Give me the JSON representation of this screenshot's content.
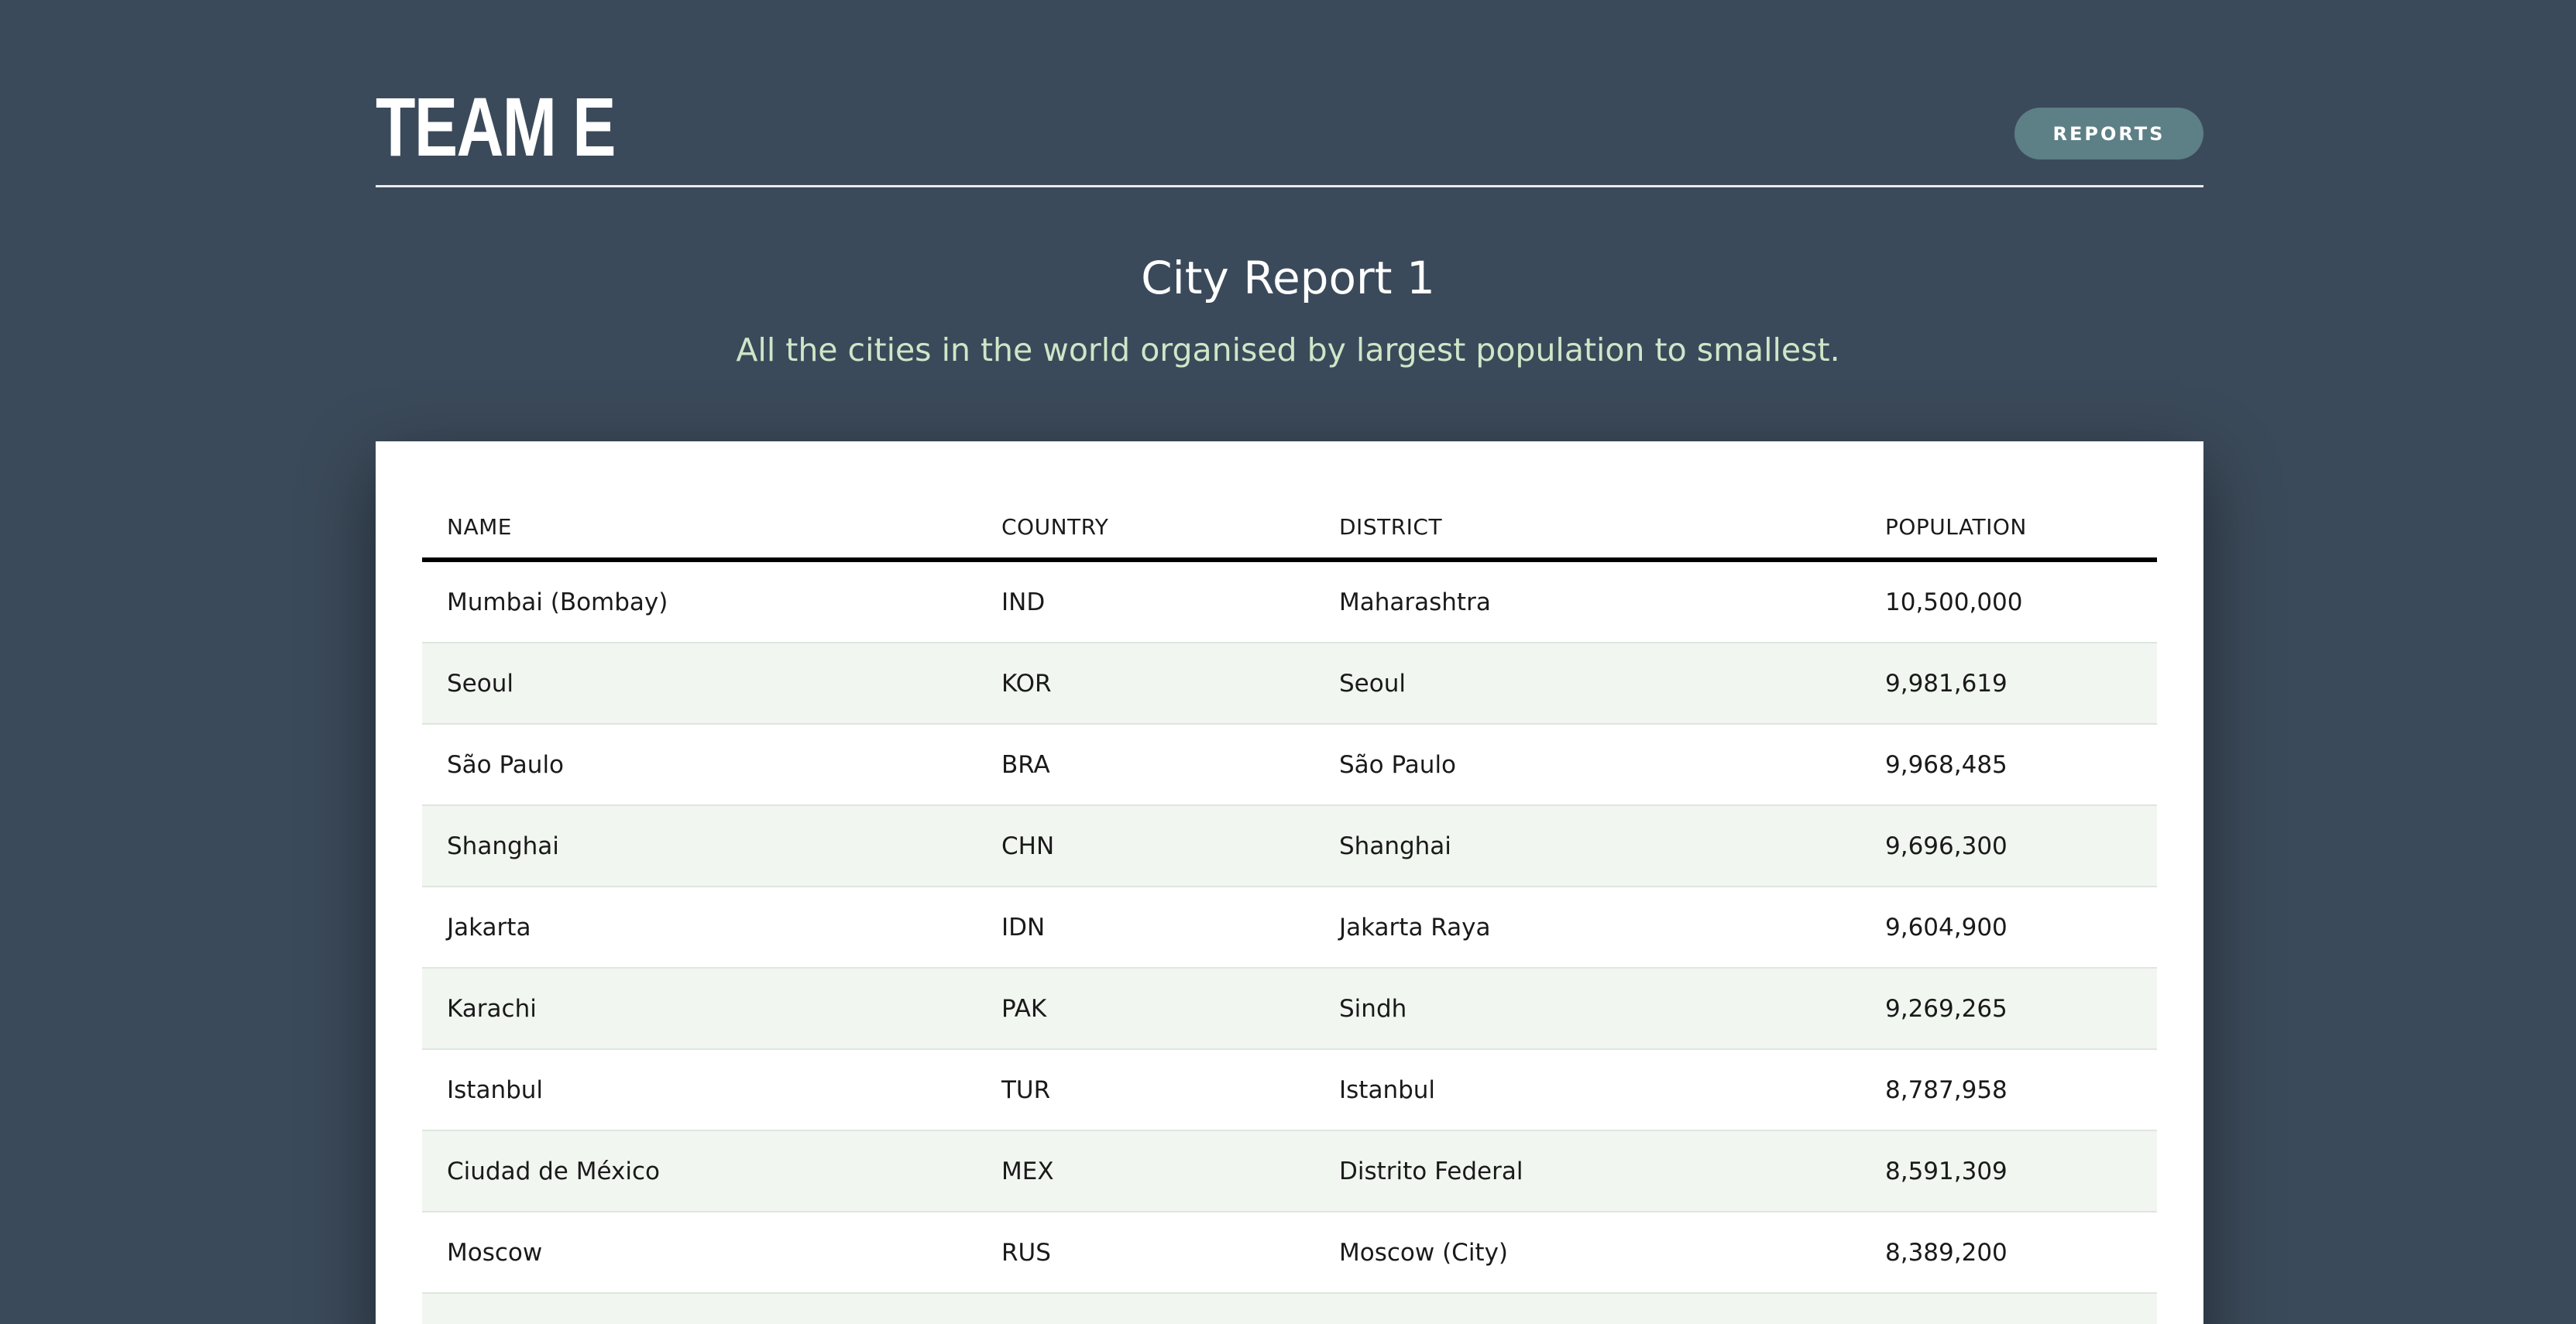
{
  "header": {
    "brand": "TEAM E",
    "reports_button": "REPORTS"
  },
  "report": {
    "title": "City Report 1",
    "subtitle": "All the cities in the world organised by largest population to smallest."
  },
  "table": {
    "columns": [
      "NAME",
      "COUNTRY",
      "DISTRICT",
      "POPULATION"
    ],
    "rows": [
      [
        "Mumbai (Bombay)",
        "IND",
        "Maharashtra",
        "10,500,000"
      ],
      [
        "Seoul",
        "KOR",
        "Seoul",
        "9,981,619"
      ],
      [
        "São Paulo",
        "BRA",
        "São Paulo",
        "9,968,485"
      ],
      [
        "Shanghai",
        "CHN",
        "Shanghai",
        "9,696,300"
      ],
      [
        "Jakarta",
        "IDN",
        "Jakarta Raya",
        "9,604,900"
      ],
      [
        "Karachi",
        "PAK",
        "Sindh",
        "9,269,265"
      ],
      [
        "Istanbul",
        "TUR",
        "Istanbul",
        "8,787,958"
      ],
      [
        "Ciudad de México",
        "MEX",
        "Distrito Federal",
        "8,591,309"
      ],
      [
        "Moscow",
        "RUS",
        "Moscow (City)",
        "8,389,200"
      ],
      [
        "",
        "",
        "",
        ""
      ]
    ]
  }
}
